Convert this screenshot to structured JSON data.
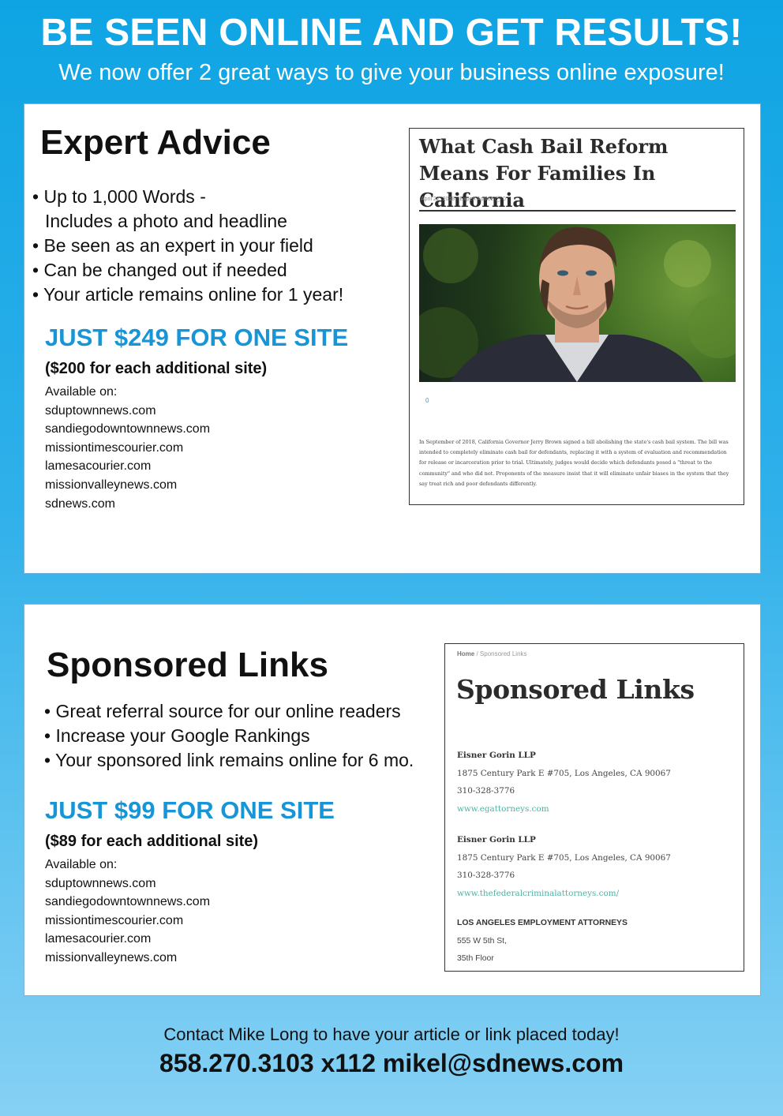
{
  "header": {
    "headline": "BE SEEN ONLINE AND GET RESULTS!",
    "subhead": "We now offer 2 great ways to give your business online exposure!"
  },
  "expert_advice": {
    "title": "Expert Advice",
    "bullets": [
      "Up to 1,000 Words -",
      "Includes a photo and headline",
      "Be seen as an expert in your field",
      "Can be changed out if needed",
      "Your article remains online for 1 year!"
    ],
    "price": "JUST $249 FOR ONE SITE",
    "additional": "($200 for each additional site)",
    "available_label": "Available on:",
    "sites": [
      "sduptownnews.com",
      "sandiegodowntownnews.com",
      "missiontimescourier.com",
      "lamesacourier.com",
      "missionvalleynews.com",
      "sdnews.com"
    ],
    "preview": {
      "title": "What Cash Bail Reform Means For Families In California",
      "meta": "April 22, 2018   ·  Expert Advice    ◯ 0",
      "share_count": "0",
      "body": "In September of 2018, California Governor Jerry Brown signed a bill abolishing the state's cash bail system. The bill was intended to completely eliminate cash bail for defendants, replacing it with a system of evaluation and recommendation for release or incarceration prior to trial. Ultimately, judges would decide which defendants posed a \"threat to the community\" and who did not. Proponents of the measure insist that it will eliminate unfair biases in the system that they say treat rich and poor defendants differently."
    }
  },
  "sponsored_links": {
    "title": "Sponsored Links",
    "bullets": [
      "Great referral source for our online readers",
      "Increase your Google Rankings",
      "Your sponsored link remains online for 6 mo."
    ],
    "price": "JUST $99 FOR ONE SITE",
    "additional": "($89 for each additional site)",
    "available_label": "Available on:",
    "sites": [
      "sduptownnews.com",
      "sandiegodowntownnews.com",
      "missiontimescourier.com",
      "lamesacourier.com",
      "missionvalleynews.com"
    ],
    "preview": {
      "crumb_home": "Home",
      "crumb_current": "Sponsored Links",
      "title": "Sponsored Links",
      "entries": [
        {
          "name": "Eisner Gorin LLP",
          "address": "1875 Century Park E #705, Los Angeles, CA 90067",
          "phone": "310-328-3776",
          "link": "www.egattorneys.com"
        },
        {
          "name": "Eisner Gorin LLP",
          "address": "1875 Century Park E #705, Los Angeles, CA 90067",
          "phone": "310-328-3776",
          "link": "www.thefederalcriminalattorneys.com/"
        },
        {
          "name": "LOS ANGELES EMPLOYMENT ATTORNEYS",
          "address": "555 W 5th St,",
          "phone": "35th Floor"
        }
      ]
    }
  },
  "contact": {
    "line1": "Contact Mike Long to have your article or link placed today!",
    "line2": "858.270.3103 x112 mikel@sdnews.com"
  }
}
